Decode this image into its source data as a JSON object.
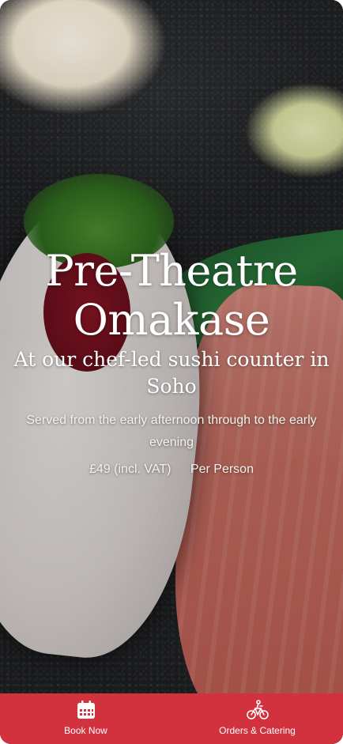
{
  "hero": {
    "title": "Pre-Theatre Omakase",
    "subtitle": "At our chef-led sushi counter in Soho",
    "description": "Served from the early afternoon through to the early evening",
    "price": "£49 (incl. VAT)",
    "per_person": "Per Person"
  },
  "tabbar": {
    "background": "#d1323e",
    "tabs": [
      {
        "label": "Book Now",
        "icon": "calendar-icon"
      },
      {
        "label": "Orders & Catering",
        "icon": "bicycle-delivery-icon"
      }
    ]
  }
}
